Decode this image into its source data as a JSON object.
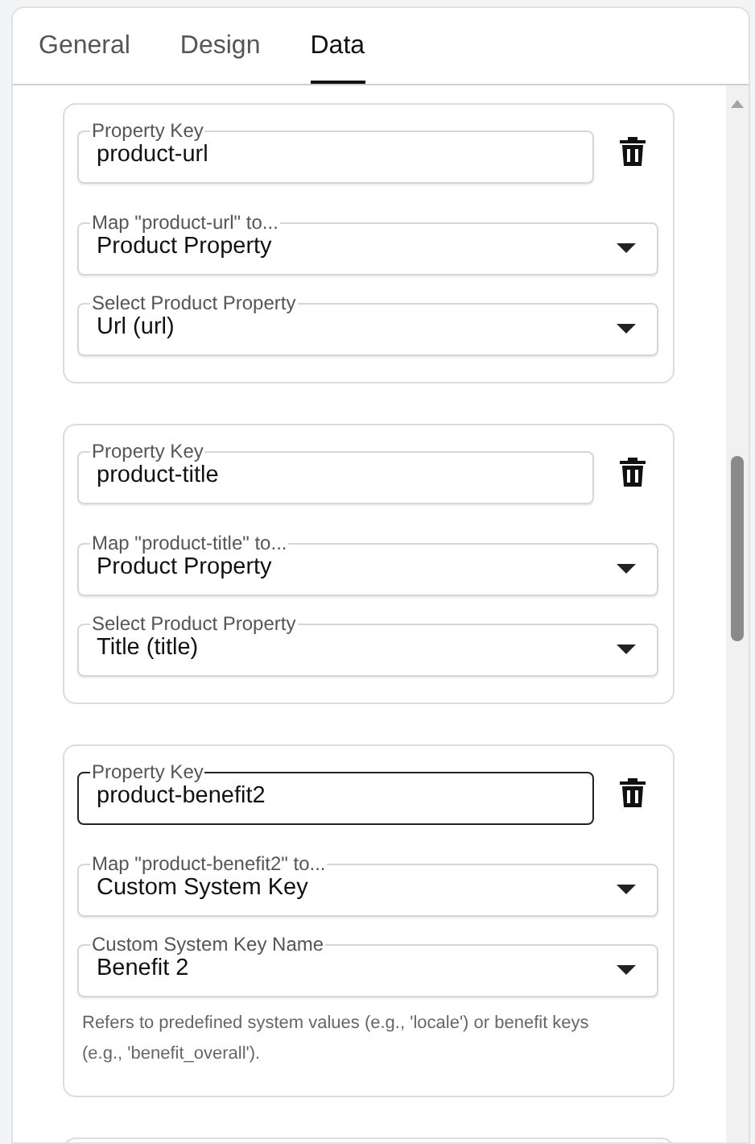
{
  "tabs": [
    {
      "label": "General",
      "selected": false
    },
    {
      "label": "Design",
      "selected": false
    },
    {
      "label": "Data",
      "selected": true
    }
  ],
  "mappings": [
    {
      "key": {
        "label": "Property Key",
        "value": "product-url",
        "focused": false
      },
      "map": {
        "label": "Map \"product-url\" to...",
        "value": "Product Property"
      },
      "detail": {
        "label": "Select Product Property",
        "value": "Url (url)"
      }
    },
    {
      "key": {
        "label": "Property Key",
        "value": "product-title",
        "focused": false
      },
      "map": {
        "label": "Map \"product-title\" to...",
        "value": "Product Property"
      },
      "detail": {
        "label": "Select Product Property",
        "value": "Title (title)"
      }
    },
    {
      "key": {
        "label": "Property Key",
        "value": "product-benefit2",
        "focused": true
      },
      "map": {
        "label": "Map \"product-benefit2\" to...",
        "value": "Custom System Key"
      },
      "detail": {
        "label": "Custom System Key Name",
        "value": "Benefit 2"
      },
      "helper": "Refers to predefined system values (e.g., 'locale') or benefit keys (e.g., 'benefit_overall')."
    }
  ]
}
